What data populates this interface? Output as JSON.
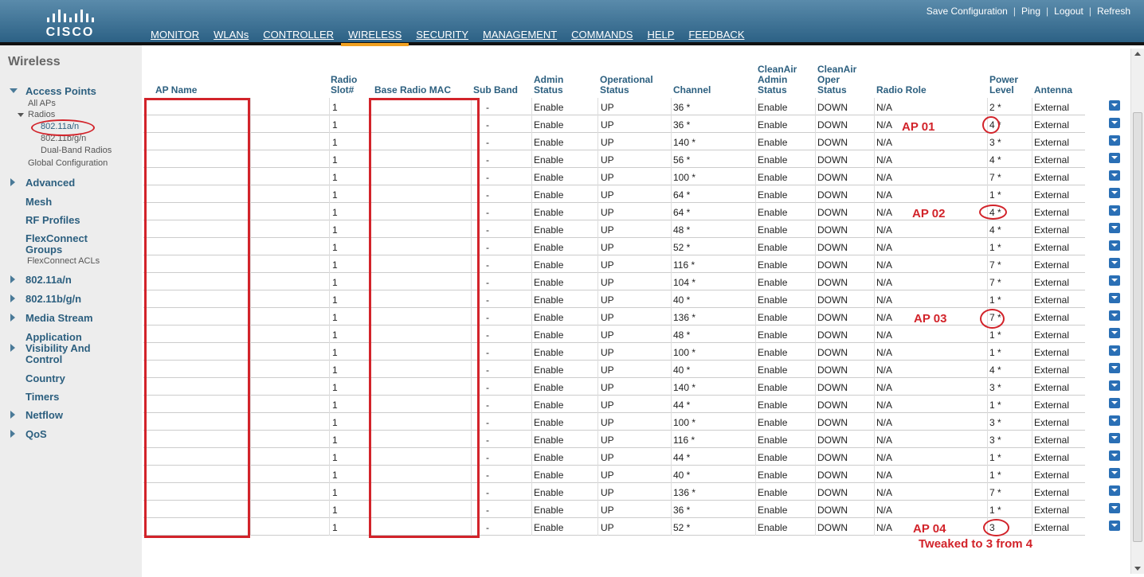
{
  "header": {
    "logo_text": "CISCO",
    "nav": [
      {
        "label": "MONITOR"
      },
      {
        "label": "WLANs"
      },
      {
        "label": "CONTROLLER"
      },
      {
        "label": "WIRELESS",
        "active": true
      },
      {
        "label": "SECURITY"
      },
      {
        "label": "MANAGEMENT"
      },
      {
        "label": "COMMANDS"
      },
      {
        "label": "HELP"
      },
      {
        "label": "FEEDBACK"
      }
    ],
    "links": [
      "Save Configuration",
      "Ping",
      "Logout",
      "Refresh"
    ]
  },
  "sidebar": {
    "title": "Wireless",
    "access_points": "Access Points",
    "all_aps": "All APs",
    "radios": "Radios",
    "radio_80211an": "802.11a/n",
    "radio_80211bgn": "802.11b/g/n",
    "dual_band": "Dual-Band Radios",
    "global_config": "Global Configuration",
    "advanced": "Advanced",
    "mesh": "Mesh",
    "rf_profiles": "RF Profiles",
    "flexconnect_groups_1": "FlexConnect",
    "flexconnect_groups_2": "Groups",
    "flexconnect_acls": "FlexConnect ACLs",
    "s_80211an": "802.11a/n",
    "s_80211bgn": "802.11b/g/n",
    "media_stream": "Media Stream",
    "avc_1": "Application",
    "avc_2": "Visibility And",
    "avc_3": "Control",
    "country": "Country",
    "timers": "Timers",
    "netflow": "Netflow",
    "qos": "QoS"
  },
  "table": {
    "headers": {
      "ap_name": "AP Name",
      "radio_slot_1": "Radio",
      "radio_slot_2": "Slot#",
      "base_mac": "Base Radio MAC",
      "sub_band": "Sub Band",
      "admin_1": "Admin",
      "admin_2": "Status",
      "oper_1": "Operational",
      "oper_2": "Status",
      "channel": "Channel",
      "ca_admin_1": "CleanAir",
      "ca_admin_2": "Admin",
      "ca_admin_3": "Status",
      "ca_oper_1": "CleanAir",
      "ca_oper_2": "Oper",
      "ca_oper_3": "Status",
      "radio_role": "Radio Role",
      "power_1": "Power",
      "power_2": "Level",
      "antenna": "Antenna"
    },
    "rows": [
      {
        "slot": "1",
        "sub": "-",
        "admin": "Enable",
        "oper": "UP",
        "channel": "36 *",
        "ca_admin": "Enable",
        "ca_oper": "DOWN",
        "role": "N/A",
        "power": "2 *",
        "antenna": "External"
      },
      {
        "slot": "1",
        "sub": "-",
        "admin": "Enable",
        "oper": "UP",
        "channel": "36 *",
        "ca_admin": "Enable",
        "ca_oper": "DOWN",
        "role": "N/A",
        "power": "4 *",
        "antenna": "External"
      },
      {
        "slot": "1",
        "sub": "-",
        "admin": "Enable",
        "oper": "UP",
        "channel": "140 *",
        "ca_admin": "Enable",
        "ca_oper": "DOWN",
        "role": "N/A",
        "power": "3 *",
        "antenna": "External"
      },
      {
        "slot": "1",
        "sub": "-",
        "admin": "Enable",
        "oper": "UP",
        "channel": "56 *",
        "ca_admin": "Enable",
        "ca_oper": "DOWN",
        "role": "N/A",
        "power": "4 *",
        "antenna": "External"
      },
      {
        "slot": "1",
        "sub": "-",
        "admin": "Enable",
        "oper": "UP",
        "channel": "100 *",
        "ca_admin": "Enable",
        "ca_oper": "DOWN",
        "role": "N/A",
        "power": "7 *",
        "antenna": "External"
      },
      {
        "slot": "1",
        "sub": "-",
        "admin": "Enable",
        "oper": "UP",
        "channel": "64 *",
        "ca_admin": "Enable",
        "ca_oper": "DOWN",
        "role": "N/A",
        "power": "1 *",
        "antenna": "External"
      },
      {
        "slot": "1",
        "sub": "-",
        "admin": "Enable",
        "oper": "UP",
        "channel": "64 *",
        "ca_admin": "Enable",
        "ca_oper": "DOWN",
        "role": "N/A",
        "power": "4 *",
        "antenna": "External"
      },
      {
        "slot": "1",
        "sub": "-",
        "admin": "Enable",
        "oper": "UP",
        "channel": "48 *",
        "ca_admin": "Enable",
        "ca_oper": "DOWN",
        "role": "N/A",
        "power": "4 *",
        "antenna": "External"
      },
      {
        "slot": "1",
        "sub": "-",
        "admin": "Enable",
        "oper": "UP",
        "channel": "52 *",
        "ca_admin": "Enable",
        "ca_oper": "DOWN",
        "role": "N/A",
        "power": "1 *",
        "antenna": "External"
      },
      {
        "slot": "1",
        "sub": "-",
        "admin": "Enable",
        "oper": "UP",
        "channel": "116 *",
        "ca_admin": "Enable",
        "ca_oper": "DOWN",
        "role": "N/A",
        "power": "7 *",
        "antenna": "External"
      },
      {
        "slot": "1",
        "sub": "-",
        "admin": "Enable",
        "oper": "UP",
        "channel": "104 *",
        "ca_admin": "Enable",
        "ca_oper": "DOWN",
        "role": "N/A",
        "power": "7 *",
        "antenna": "External"
      },
      {
        "slot": "1",
        "sub": "-",
        "admin": "Enable",
        "oper": "UP",
        "channel": "40 *",
        "ca_admin": "Enable",
        "ca_oper": "DOWN",
        "role": "N/A",
        "power": "1 *",
        "antenna": "External"
      },
      {
        "slot": "1",
        "sub": "-",
        "admin": "Enable",
        "oper": "UP",
        "channel": "136 *",
        "ca_admin": "Enable",
        "ca_oper": "DOWN",
        "role": "N/A",
        "power": "7 *",
        "antenna": "External"
      },
      {
        "slot": "1",
        "sub": "-",
        "admin": "Enable",
        "oper": "UP",
        "channel": "48 *",
        "ca_admin": "Enable",
        "ca_oper": "DOWN",
        "role": "N/A",
        "power": "1 *",
        "antenna": "External"
      },
      {
        "slot": "1",
        "sub": "-",
        "admin": "Enable",
        "oper": "UP",
        "channel": "100 *",
        "ca_admin": "Enable",
        "ca_oper": "DOWN",
        "role": "N/A",
        "power": "1 *",
        "antenna": "External"
      },
      {
        "slot": "1",
        "sub": "-",
        "admin": "Enable",
        "oper": "UP",
        "channel": "40 *",
        "ca_admin": "Enable",
        "ca_oper": "DOWN",
        "role": "N/A",
        "power": "4 *",
        "antenna": "External"
      },
      {
        "slot": "1",
        "sub": "-",
        "admin": "Enable",
        "oper": "UP",
        "channel": "140 *",
        "ca_admin": "Enable",
        "ca_oper": "DOWN",
        "role": "N/A",
        "power": "3 *",
        "antenna": "External"
      },
      {
        "slot": "1",
        "sub": "-",
        "admin": "Enable",
        "oper": "UP",
        "channel": "44 *",
        "ca_admin": "Enable",
        "ca_oper": "DOWN",
        "role": "N/A",
        "power": "1 *",
        "antenna": "External"
      },
      {
        "slot": "1",
        "sub": "-",
        "admin": "Enable",
        "oper": "UP",
        "channel": "100 *",
        "ca_admin": "Enable",
        "ca_oper": "DOWN",
        "role": "N/A",
        "power": "3 *",
        "antenna": "External"
      },
      {
        "slot": "1",
        "sub": "-",
        "admin": "Enable",
        "oper": "UP",
        "channel": "116 *",
        "ca_admin": "Enable",
        "ca_oper": "DOWN",
        "role": "N/A",
        "power": "3 *",
        "antenna": "External"
      },
      {
        "slot": "1",
        "sub": "-",
        "admin": "Enable",
        "oper": "UP",
        "channel": "44 *",
        "ca_admin": "Enable",
        "ca_oper": "DOWN",
        "role": "N/A",
        "power": "1 *",
        "antenna": "External"
      },
      {
        "slot": "1",
        "sub": "-",
        "admin": "Enable",
        "oper": "UP",
        "channel": "40 *",
        "ca_admin": "Enable",
        "ca_oper": "DOWN",
        "role": "N/A",
        "power": "1 *",
        "antenna": "External"
      },
      {
        "slot": "1",
        "sub": "-",
        "admin": "Enable",
        "oper": "UP",
        "channel": "136 *",
        "ca_admin": "Enable",
        "ca_oper": "DOWN",
        "role": "N/A",
        "power": "7 *",
        "antenna": "External"
      },
      {
        "slot": "1",
        "sub": "-",
        "admin": "Enable",
        "oper": "UP",
        "channel": "36 *",
        "ca_admin": "Enable",
        "ca_oper": "DOWN",
        "role": "N/A",
        "power": "1 *",
        "antenna": "External"
      },
      {
        "slot": "1",
        "sub": "-",
        "admin": "Enable",
        "oper": "UP",
        "channel": "52 *",
        "ca_admin": "Enable",
        "ca_oper": "DOWN",
        "role": "N/A",
        "power": "3",
        "antenna": "External"
      }
    ]
  },
  "annotations": {
    "ap01": "AP 01",
    "ap02": "AP 02",
    "ap03": "AP 03",
    "ap04": "AP 04",
    "note": "Tweaked to 3 from 4"
  },
  "colors": {
    "header_top": "#5a8bab",
    "header_bottom": "#2c6185",
    "accent": "#f0a020",
    "annotation_red": "#d2232a",
    "heading_blue": "#2c5f7f"
  }
}
